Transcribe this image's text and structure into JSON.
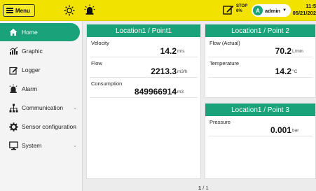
{
  "topbar": {
    "menu_label": "Menu",
    "stop_line1": "STOP",
    "stop_line2": "6%",
    "user_initial": "A",
    "user_name": "admin",
    "time": "11:5",
    "date": "05/21/202"
  },
  "sidebar": {
    "items": [
      {
        "label": "Home",
        "icon": "home-icon"
      },
      {
        "label": "Graphic",
        "icon": "chart-icon"
      },
      {
        "label": "Logger",
        "icon": "logger-icon"
      },
      {
        "label": "Alarm",
        "icon": "alarm-icon"
      },
      {
        "label": "Communication",
        "icon": "network-icon"
      },
      {
        "label": "Sensor configuration",
        "icon": "gear-icon"
      },
      {
        "label": "System",
        "icon": "monitor-icon"
      }
    ]
  },
  "cards": {
    "point1": {
      "title": "Location1 / Point1",
      "rows": [
        {
          "label": "Velocity",
          "value": "14.2",
          "unit": "m/s"
        },
        {
          "label": "Flow",
          "value": "2213.3",
          "unit": "m3/h"
        },
        {
          "label": "Consumption",
          "value": "849966914",
          "unit": "m3"
        }
      ]
    },
    "point2": {
      "title": "Location1 / Point 2",
      "rows": [
        {
          "label": "Flow (Actual)",
          "value": "70.2",
          "unit": "L/min"
        },
        {
          "label": "Temperature",
          "value": "14.2",
          "unit": "°C"
        }
      ]
    },
    "point3": {
      "title": "Location1 / Point 3",
      "rows": [
        {
          "label": "Pressure",
          "value": "0.001",
          "unit": "bar"
        }
      ]
    }
  },
  "pager": {
    "current": "1",
    "separator": "/",
    "total": "1"
  },
  "colors": {
    "topbar": "#f2e200",
    "accent": "#1aa37a"
  }
}
